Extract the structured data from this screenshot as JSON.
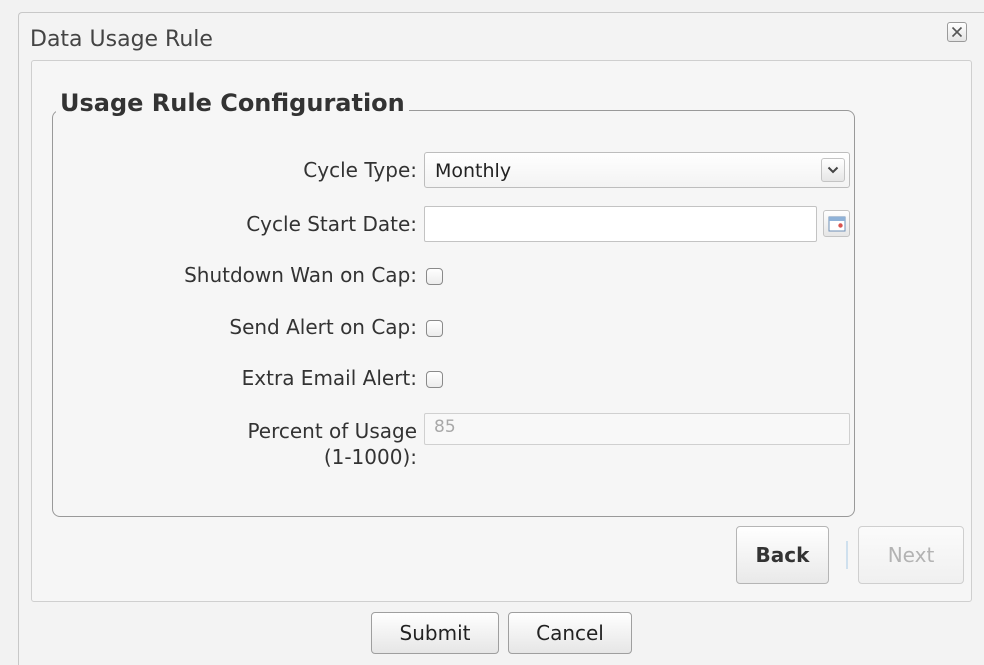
{
  "dialog": {
    "title": "Data Usage Rule"
  },
  "form": {
    "legend": "Usage Rule Configuration",
    "cycle_type": {
      "label": "Cycle Type:",
      "value": "Monthly"
    },
    "cycle_start_date": {
      "label": "Cycle Start Date:",
      "value": ""
    },
    "shutdown_wan": {
      "label": "Shutdown Wan on Cap:",
      "checked": false
    },
    "send_alert": {
      "label": "Send Alert on Cap:",
      "checked": false
    },
    "extra_email": {
      "label": "Extra Email Alert:",
      "checked": false
    },
    "percent_usage": {
      "label_line1": "Percent of Usage",
      "label_line2": "(1-1000):",
      "value": "85"
    }
  },
  "wizard": {
    "back_label": "Back",
    "next_label": "Next"
  },
  "footer": {
    "submit_label": "Submit",
    "cancel_label": "Cancel"
  },
  "icons": {
    "close": "close-icon",
    "dropdown": "chevron-down-icon",
    "calendar": "calendar-icon"
  }
}
